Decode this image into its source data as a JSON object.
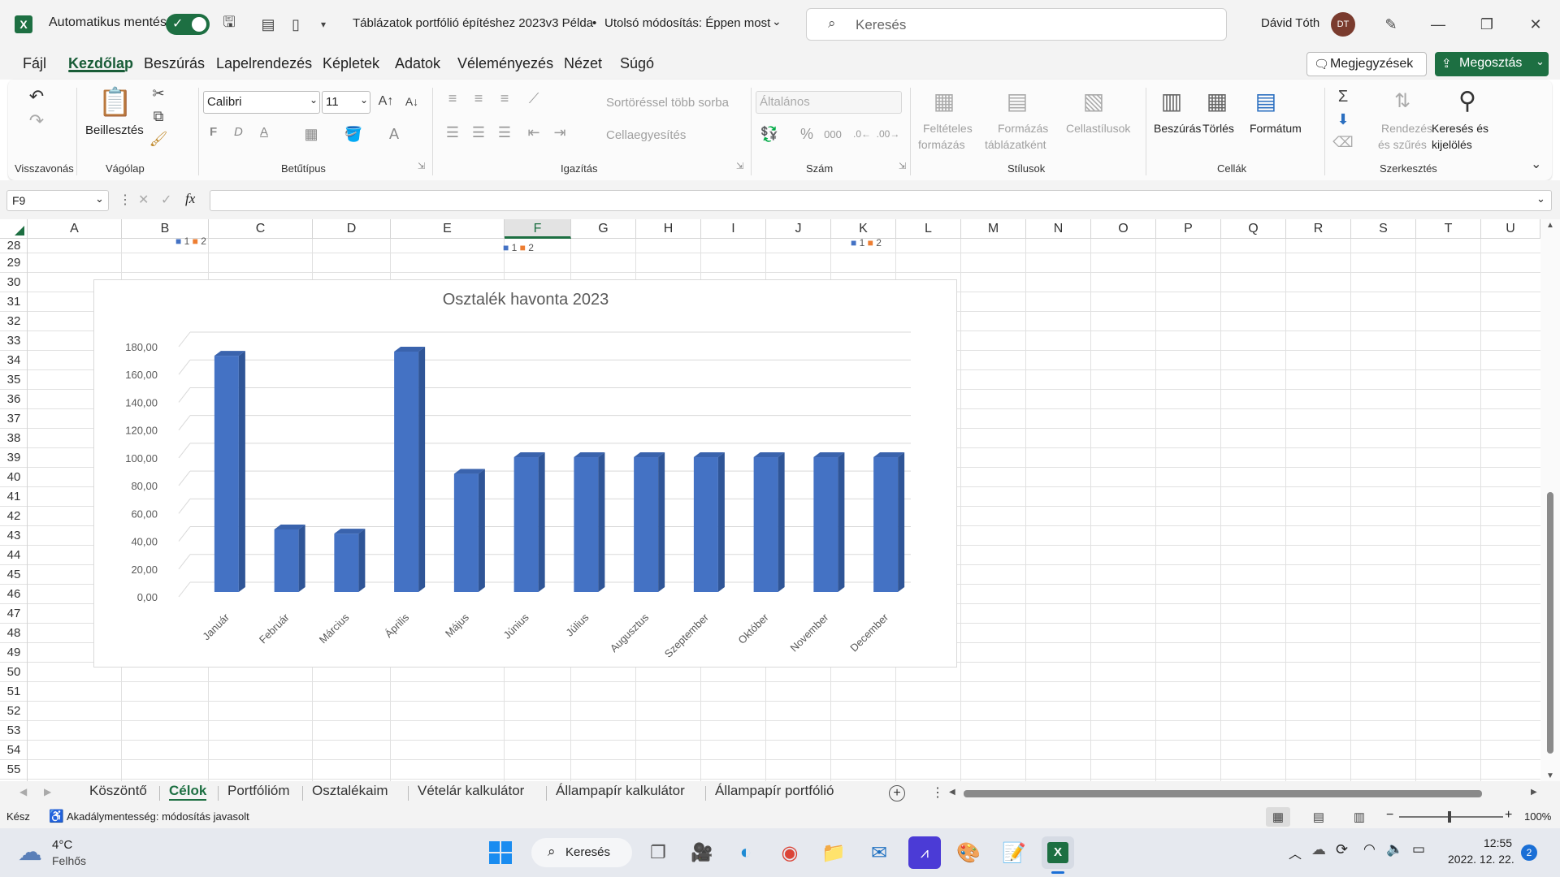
{
  "app": {
    "autosave_label": "Automatikus mentés",
    "title": "Táblázatok portfólió építéshez 2023v3 Példa",
    "title_sep": "•",
    "modified": "Utolsó módosítás: Éppen most",
    "search_placeholder": "Keresés",
    "user_name": "Dávid Tóth",
    "user_initials": "DT"
  },
  "menu": {
    "items": [
      "Fájl",
      "Kezdőlap",
      "Beszúrás",
      "Lapelrendezés",
      "Képletek",
      "Adatok",
      "Véleményezés",
      "Nézet",
      "Súgó"
    ],
    "comments_label": "Megjegyzések",
    "share_label": "Megosztás"
  },
  "ribbon": {
    "undo_group": "Visszavonás",
    "paste_label": "Beillesztés",
    "clipboard_group": "Vágólap",
    "font_name": "Calibri",
    "font_size": "11",
    "bold": "F",
    "italic": "D",
    "underline": "A",
    "font_group": "Betűtípus",
    "wrap_label": "Sortöréssel több sorba",
    "merge_label": "Cellaegyesítés",
    "align_group": "Igazítás",
    "number_format": "Általános",
    "number_group": "Szám",
    "cond_format_1": "Feltételes",
    "cond_format_2": "formázás",
    "format_table_1": "Formázás",
    "format_table_2": "táblázatként",
    "cell_styles": "Cellastílusok",
    "styles_group": "Stílusok",
    "insert_label": "Beszúrás",
    "delete_label": "Törlés",
    "format_label": "Formátum",
    "cells_group": "Cellák",
    "sort_1": "Rendezés",
    "sort_2": "és szűrés",
    "find_1": "Keresés és",
    "find_2": "kijelölés",
    "edit_group": "Szerkesztés"
  },
  "formula": {
    "name_box": "F9",
    "fx": "fx",
    "content": ""
  },
  "grid": {
    "columns": [
      "A",
      "B",
      "C",
      "D",
      "E",
      "F",
      "G",
      "H",
      "I",
      "J",
      "K",
      "L",
      "M",
      "N",
      "O",
      "P",
      "Q",
      "R",
      "S",
      "T",
      "U"
    ],
    "rows": [
      "28",
      "29",
      "30",
      "31",
      "32",
      "33",
      "34",
      "35",
      "36",
      "37",
      "38",
      "39",
      "40",
      "41",
      "42",
      "43",
      "44",
      "45",
      "46",
      "47",
      "48",
      "49",
      "50",
      "51",
      "52",
      "53",
      "54",
      "55"
    ],
    "mini_legends": [
      "1",
      "2"
    ]
  },
  "chart_data": {
    "type": "bar",
    "title": "Osztalék havonta 2023",
    "categories": [
      "Január",
      "Február",
      "Március",
      "Április",
      "Május",
      "Június",
      "Július",
      "Augusztus",
      "Szeptember",
      "Október",
      "November",
      "December"
    ],
    "values": [
      170,
      45,
      42,
      173,
      85,
      97,
      97,
      97,
      97,
      97,
      97,
      97
    ],
    "ylim": [
      0,
      180
    ],
    "yticks": [
      "0,00",
      "20,00",
      "40,00",
      "60,00",
      "80,00",
      "100,00",
      "120,00",
      "140,00",
      "160,00",
      "180,00"
    ],
    "grid": true,
    "color": "#4472c4"
  },
  "sheets": {
    "tabs": [
      "Köszöntő",
      "Célok",
      "Portfólióm",
      "Osztalékaim",
      "Vételár kalkulátor",
      "Állampapír kalkulátor",
      "Állampapír portfólió"
    ],
    "active": "Célok"
  },
  "status": {
    "ready": "Kész",
    "accessibility": "Akadálymentesség: módosítás javasolt",
    "zoom": "100%"
  },
  "taskbar": {
    "temp": "4°C",
    "weather": "Felhős",
    "search": "Keresés",
    "time": "12:55",
    "date": "2022. 12. 22.",
    "notif": "2"
  }
}
